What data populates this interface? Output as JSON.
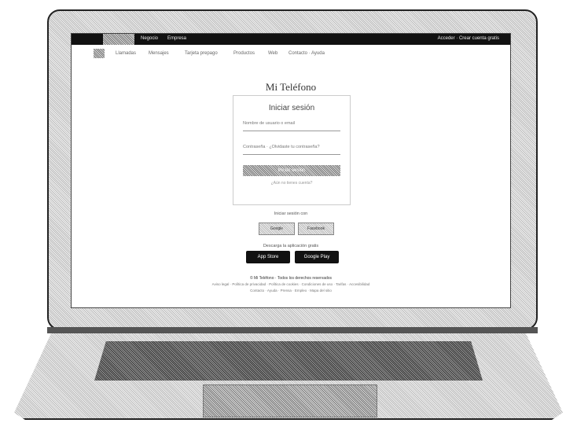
{
  "topbar": {
    "left_items": [
      "Negocio",
      "Empresa"
    ],
    "right_text": "Acceder · Crear cuenta gratis"
  },
  "nav": {
    "items": [
      "Llamadas",
      "Mensajes",
      "Tarjeta prepago",
      "Productos",
      "Web",
      "Contacto · Ayuda"
    ]
  },
  "brand": "Mi Teléfono",
  "login": {
    "title": "Iniciar sesión",
    "user_placeholder": "Nombre de usuario o email",
    "password_placeholder": "Contraseña · ¿Olvidaste tu contraseña?",
    "submit_label": "Iniciar sesión",
    "forgot_label": "¿Aún no tienes cuenta?"
  },
  "social": {
    "label": "Iniciar sesión con",
    "buttons": [
      "Google",
      "Facebook"
    ]
  },
  "downloads": {
    "label": "Descarga la aplicación gratis",
    "buttons": [
      "App Store",
      "Google Play"
    ]
  },
  "footer": {
    "copyright": "© Mi Teléfono · Todos los derechos reservados",
    "legal": "Aviso legal · Política de privacidad · Política de cookies · Condiciones de uso · Tarifas · Accesibilidad",
    "legal2": "Contacto · Ayuda · Prensa · Empleo · Mapa del sitio"
  }
}
